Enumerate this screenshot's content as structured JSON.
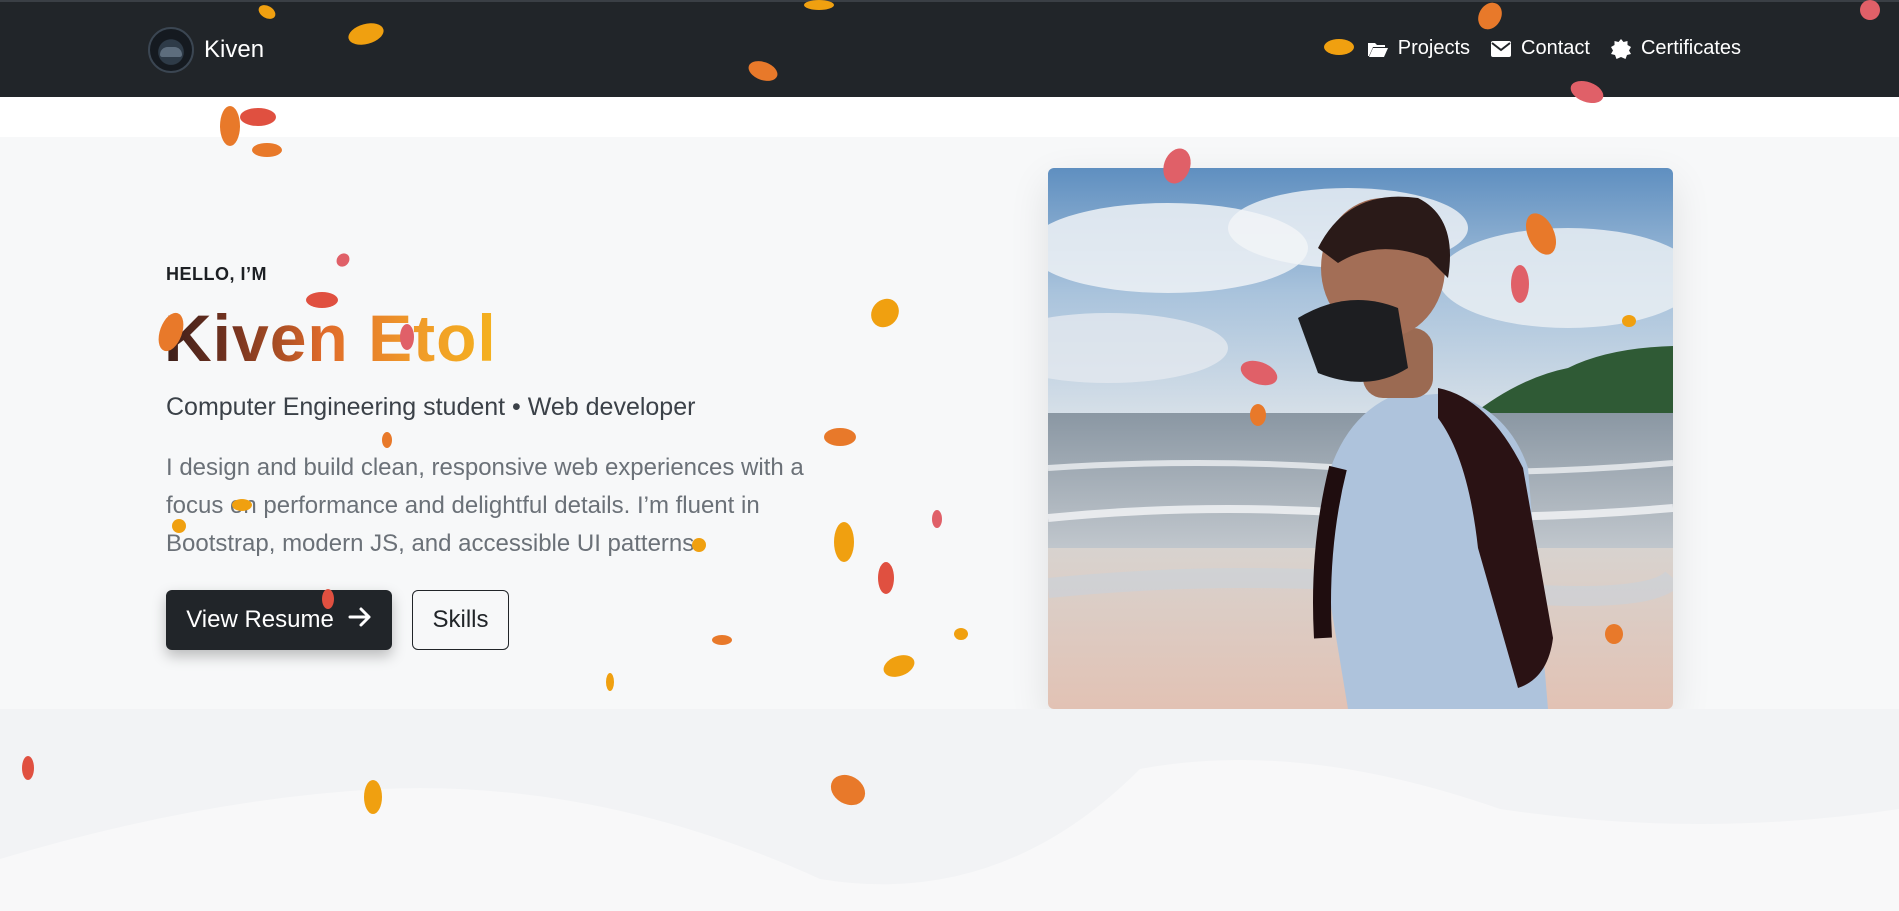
{
  "navbar": {
    "brand": "Kiven",
    "links": [
      {
        "label": "Projects",
        "icon": "folder-open-icon"
      },
      {
        "label": "Contact",
        "icon": "envelope-icon"
      },
      {
        "label": "Certificates",
        "icon": "certificate-badge-icon"
      }
    ]
  },
  "hero": {
    "eyebrow": "HELLO, I’M",
    "name": "Kiven Etol",
    "subtitle": "Computer Engineering student • Web developer",
    "bio": "I design and build clean, responsive web experiences with a focus on performance and delightful details. I’m fluent in Bootstrap, modern JS, and accessible UI patterns.",
    "primary_button": "View Resume",
    "secondary_button": "Skills"
  },
  "colors": {
    "navbar_bg": "#212529",
    "petal_orange": "#e8792a",
    "petal_amber": "#f0a010",
    "petal_red": "#e05040",
    "petal_pink": "#e06068"
  }
}
